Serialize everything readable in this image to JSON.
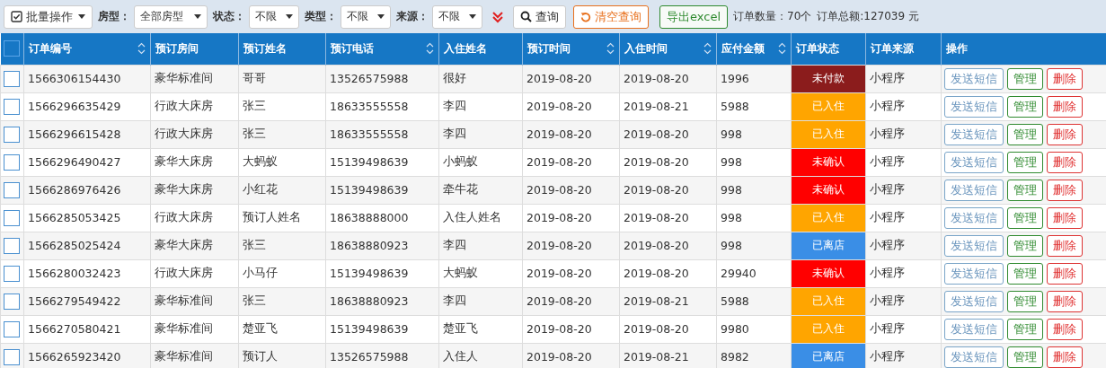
{
  "toolbar": {
    "batch_button": "批量操作",
    "filters": [
      {
        "label": "房型：",
        "value": "全部房型"
      },
      {
        "label": "状态：",
        "value": "不限"
      },
      {
        "label": "类型：",
        "value": "不限"
      },
      {
        "label": "来源：",
        "value": "不限"
      }
    ],
    "search_button": "查询",
    "clear_button": "清空查询",
    "export_button": "导出excel",
    "order_count": "订单数量：70个",
    "order_total": "订单总额:127039 元"
  },
  "table": {
    "select_all_checked": false,
    "columns": [
      {
        "label": "订单编号",
        "sortable": true
      },
      {
        "label": "预订房间",
        "sortable": false
      },
      {
        "label": "预订姓名",
        "sortable": false
      },
      {
        "label": "预订电话",
        "sortable": true
      },
      {
        "label": "入住姓名",
        "sortable": false
      },
      {
        "label": "预订时间",
        "sortable": true
      },
      {
        "label": "入住时间",
        "sortable": true
      },
      {
        "label": "应付金额",
        "sortable": true
      },
      {
        "label": "订单状态",
        "sortable": false
      },
      {
        "label": "订单来源",
        "sortable": false
      },
      {
        "label": "操作",
        "sortable": false
      }
    ],
    "rows": [
      {
        "checked": false,
        "order_no": "1566306154430",
        "room": "豪华标准间",
        "booker": "哥哥",
        "phone": "13526575988",
        "guest": "很好",
        "book_date": "2019-08-20",
        "checkin_date": "2019-08-20",
        "amount": "1996",
        "status": "未付款",
        "color": "#8b1c1c",
        "source": "小程序",
        "actions": [
          "发送短信",
          "管理",
          "删除"
        ]
      },
      {
        "checked": false,
        "order_no": "1566296635429",
        "room": "行政大床房",
        "booker": "张三",
        "phone": "18633555558",
        "guest": "李四",
        "book_date": "2019-08-20",
        "checkin_date": "2019-08-21",
        "amount": "5988",
        "status": "已入住",
        "color": "#ffa500",
        "source": "小程序",
        "actions": [
          "发送短信",
          "管理",
          "删除"
        ]
      },
      {
        "checked": false,
        "order_no": "1566296615428",
        "room": "行政大床房",
        "booker": "张三",
        "phone": "18633555558",
        "guest": "李四",
        "book_date": "2019-08-20",
        "checkin_date": "2019-08-20",
        "amount": "998",
        "status": "已入住",
        "color": "#ffa500",
        "source": "小程序",
        "actions": [
          "发送短信",
          "管理",
          "删除"
        ]
      },
      {
        "checked": false,
        "order_no": "1566296490427",
        "room": "豪华大床房",
        "booker": "大蚂蚁",
        "phone": "15139498639",
        "guest": "小蚂蚁",
        "book_date": "2019-08-20",
        "checkin_date": "2019-08-20",
        "amount": "998",
        "status": "未确认",
        "color": "#ff0000",
        "source": "小程序",
        "actions": [
          "发送短信",
          "管理",
          "删除"
        ]
      },
      {
        "checked": false,
        "order_no": "1566286976426",
        "room": "豪华大床房",
        "booker": "小红花",
        "phone": "15139498639",
        "guest": "牵牛花",
        "book_date": "2019-08-20",
        "checkin_date": "2019-08-20",
        "amount": "998",
        "status": "未确认",
        "color": "#ff0000",
        "source": "小程序",
        "actions": [
          "发送短信",
          "管理",
          "删除"
        ]
      },
      {
        "checked": false,
        "order_no": "1566285053425",
        "room": "行政大床房",
        "booker": "预订人姓名",
        "phone": "18638888000",
        "guest": "入住人姓名",
        "book_date": "2019-08-20",
        "checkin_date": "2019-08-20",
        "amount": "998",
        "status": "已入住",
        "color": "#ffa500",
        "source": "小程序",
        "actions": [
          "发送短信",
          "管理",
          "删除"
        ]
      },
      {
        "checked": false,
        "order_no": "1566285025424",
        "room": "豪华大床房",
        "booker": "张三",
        "phone": "18638880923",
        "guest": "李四",
        "book_date": "2019-08-20",
        "checkin_date": "2019-08-20",
        "amount": "998",
        "status": "已离店",
        "color": "#3a8ee6",
        "source": "小程序",
        "actions": [
          "发送短信",
          "管理",
          "删除"
        ]
      },
      {
        "checked": false,
        "order_no": "1566280032423",
        "room": "行政大床房",
        "booker": "小马仔",
        "phone": "15139498639",
        "guest": "大蚂蚁",
        "book_date": "2019-08-20",
        "checkin_date": "2019-08-20",
        "amount": "29940",
        "status": "未确认",
        "color": "#ff0000",
        "source": "小程序",
        "actions": [
          "发送短信",
          "管理",
          "删除"
        ]
      },
      {
        "checked": false,
        "order_no": "1566279549422",
        "room": "豪华标准间",
        "booker": "张三",
        "phone": "18638880923",
        "guest": "李四",
        "book_date": "2019-08-20",
        "checkin_date": "2019-08-21",
        "amount": "5988",
        "status": "已入住",
        "color": "#ffa500",
        "source": "小程序",
        "actions": [
          "发送短信",
          "管理",
          "删除"
        ]
      },
      {
        "checked": false,
        "order_no": "1566270580421",
        "room": "豪华标准间",
        "booker": "楚亚飞",
        "phone": "15139498639",
        "guest": "楚亚飞",
        "book_date": "2019-08-20",
        "checkin_date": "2019-08-20",
        "amount": "9980",
        "status": "已入住",
        "color": "#ffa500",
        "source": "小程序",
        "actions": [
          "发送短信",
          "管理",
          "删除"
        ]
      },
      {
        "checked": false,
        "order_no": "1566265923420",
        "room": "豪华标准间",
        "booker": "预订人",
        "phone": "13526575988",
        "guest": "入住人",
        "book_date": "2019-08-20",
        "checkin_date": "2019-08-21",
        "amount": "8982",
        "status": "已离店",
        "color": "#3a8ee6",
        "source": "小程序",
        "actions": [
          "发送短信",
          "管理",
          "删除"
        ]
      }
    ]
  }
}
